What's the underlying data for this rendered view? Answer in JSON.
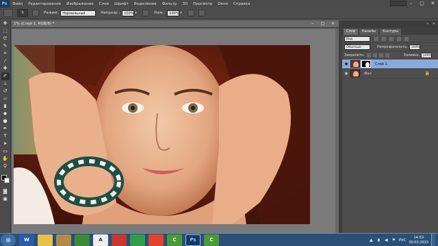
{
  "menubar": {
    "logo": "Ps",
    "items": [
      "Файл",
      "Редактирование",
      "Изображение",
      "Слои",
      "Шрифт",
      "Выделение",
      "Фильтр",
      "3D",
      "Просмотр",
      "Окно",
      "Справка"
    ],
    "window_controls": [
      "–",
      "□",
      "✕"
    ]
  },
  "options": {
    "brush_size": "9",
    "mode_label": "Режим:",
    "mode_value": "Нормальный",
    "opacity_label": "Непрозр.:",
    "opacity_value": "100%",
    "flow_label": "Наж.:",
    "flow_value": "100%"
  },
  "document": {
    "tab_title": "1% (Слой 1, RGB/8) *",
    "controls": [
      "–",
      "□",
      "✕"
    ]
  },
  "panel": {
    "tabs": [
      "Слои",
      "Каналы",
      "Контуры"
    ],
    "kind_value": "Вид",
    "blend_value": "Обычные",
    "opacity_label": "Непрозрачность:",
    "opacity_value": "100%",
    "lock_label": "Закрепить:",
    "fill_label": "Заливка:",
    "fill_value": "100%",
    "layers": [
      {
        "name": "Слой 1",
        "selected": true
      },
      {
        "name": "Фон",
        "selected": false
      }
    ]
  },
  "taskbar": {
    "apps": [
      "W",
      "",
      "A",
      "",
      "",
      "",
      "C",
      "Ps",
      "C"
    ],
    "lang": "РУС",
    "time": "14:50",
    "date": "30.03.2013"
  },
  "colors": {
    "taskbar": "#2b4f77",
    "layer_selected": "#8aa8de",
    "ps_blue": "#1d3b5e"
  }
}
